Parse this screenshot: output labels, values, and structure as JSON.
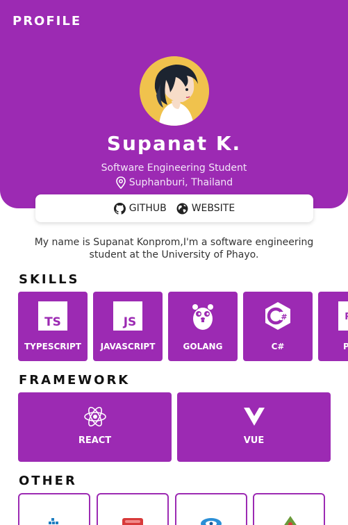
{
  "header": {
    "title": "PROFILE",
    "name": "Supanat K.",
    "role": "Software Engineering Student",
    "location": "Suphanburi, Thailand"
  },
  "links": {
    "github_label": "GITHUB",
    "website_label": "WEBSITE"
  },
  "bio": "My name is Supanat Konprom,I'm a software engineering student at the University of Phayo.",
  "skills": {
    "title": "SKILLS",
    "items": [
      {
        "label": "TYPESCRIPT",
        "icon": "typescript-icon"
      },
      {
        "label": "JAVASCRIPT",
        "icon": "javascript-icon"
      },
      {
        "label": "GOLANG",
        "icon": "gopher-icon"
      },
      {
        "label": "C#",
        "icon": "csharp-icon"
      },
      {
        "label": "P",
        "icon": "php-icon"
      }
    ]
  },
  "framework": {
    "title": "FRAMEWORK",
    "items": [
      {
        "label": "REACT",
        "icon": "react-icon"
      },
      {
        "label": "VUE",
        "icon": "vue-icon"
      }
    ]
  },
  "other": {
    "title": "OTHER",
    "items": [
      {
        "icon": "docker-icon"
      },
      {
        "icon": "redis-icon"
      },
      {
        "icon": "database-icon"
      },
      {
        "icon": "android-icon"
      }
    ]
  },
  "colors": {
    "accent": "#9c2ab3",
    "avatar_bg": "#f0c24d"
  }
}
